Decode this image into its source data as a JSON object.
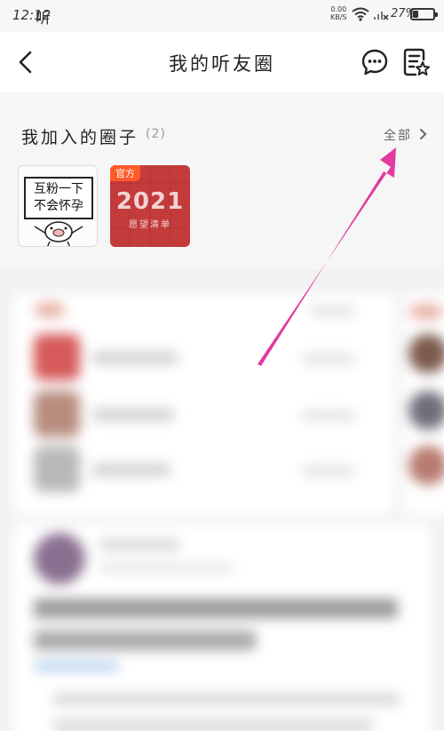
{
  "status_bar": {
    "time": "12:12",
    "app_glyph": "听",
    "net_speed_value": "0.00",
    "net_speed_unit": "KB/S",
    "battery_text": "27%",
    "battery_level": 0.27
  },
  "header": {
    "title": "我的听友圈",
    "icons": [
      "back-arrow-icon",
      "message-icon",
      "notes-icon"
    ]
  },
  "circles": {
    "section_title": "我加入的圈子",
    "count": "(2)",
    "view_all_label": "全部",
    "cards": [
      {
        "sign_line_1": "互粉一下",
        "sign_line_2": "不会怀孕"
      },
      {
        "badge": "官方",
        "year": "2021",
        "subtitle": "愿望清单"
      }
    ]
  },
  "colors": {
    "accent_red": "#c43b3b",
    "badge_orange": "#ff5a2a",
    "annotation_pink": "#e33aa0"
  }
}
